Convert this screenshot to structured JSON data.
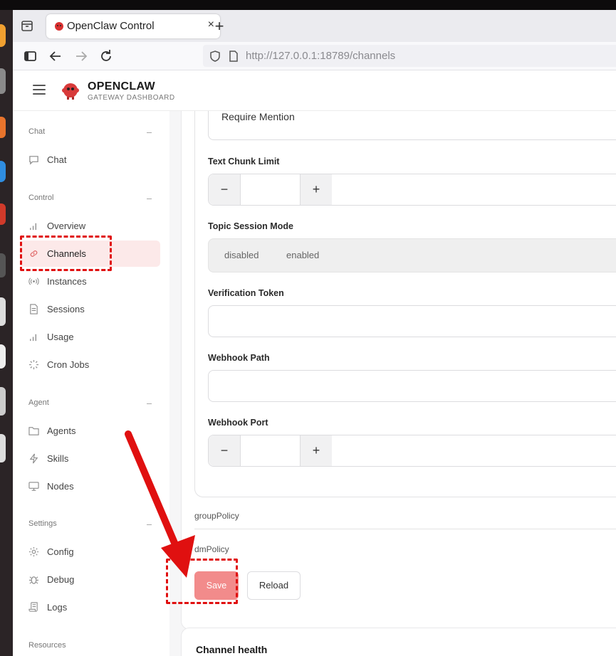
{
  "browser": {
    "tab_title": "OpenClaw Control",
    "tab_close": "×",
    "new_tab": "+",
    "url_prefix": "http://127.0.0.1",
    "url_rest": ":18789/channels"
  },
  "app": {
    "brand_name": "OPENCLAW",
    "brand_sub": "GATEWAY DASHBOARD"
  },
  "sidebar": {
    "groups": [
      {
        "label": "Chat"
      },
      {
        "label": "Control"
      },
      {
        "label": "Agent"
      },
      {
        "label": "Settings"
      },
      {
        "label": "Resources"
      }
    ],
    "items": [
      {
        "label": "Chat",
        "icon": "chat-icon"
      },
      {
        "label": "Overview",
        "icon": "bar-chart-icon"
      },
      {
        "label": "Channels",
        "icon": "link-icon",
        "active": true
      },
      {
        "label": "Instances",
        "icon": "broadcast-icon"
      },
      {
        "label": "Sessions",
        "icon": "document-icon"
      },
      {
        "label": "Usage",
        "icon": "bar-chart-icon"
      },
      {
        "label": "Cron Jobs",
        "icon": "loader-icon"
      },
      {
        "label": "Agents",
        "icon": "folder-icon"
      },
      {
        "label": "Skills",
        "icon": "lightning-icon"
      },
      {
        "label": "Nodes",
        "icon": "monitor-icon"
      },
      {
        "label": "Config",
        "icon": "gear-icon"
      },
      {
        "label": "Debug",
        "icon": "bug-icon"
      },
      {
        "label": "Logs",
        "icon": "scroll-icon"
      }
    ]
  },
  "form": {
    "require_mention": "Require Mention",
    "text_chunk_limit_label": "Text Chunk Limit",
    "text_chunk_limit_value": "",
    "minus": "−",
    "plus": "+",
    "topic_session_mode_label": "Topic Session Mode",
    "topic_options": [
      "disabled",
      "enabled"
    ],
    "verification_token_label": "Verification Token",
    "verification_token_value": "",
    "webhook_path_label": "Webhook Path",
    "webhook_path_value": "",
    "webhook_port_label": "Webhook Port",
    "webhook_port_value": "",
    "group_policy": "groupPolicy",
    "dm_policy": "dmPolicy",
    "save_label": "Save",
    "reload_label": "Reload"
  },
  "channel_health_title": "Channel health",
  "colors": {
    "accent": "#f28b8b",
    "active_bg": "#fce9e9",
    "annotation": "#e01010"
  }
}
